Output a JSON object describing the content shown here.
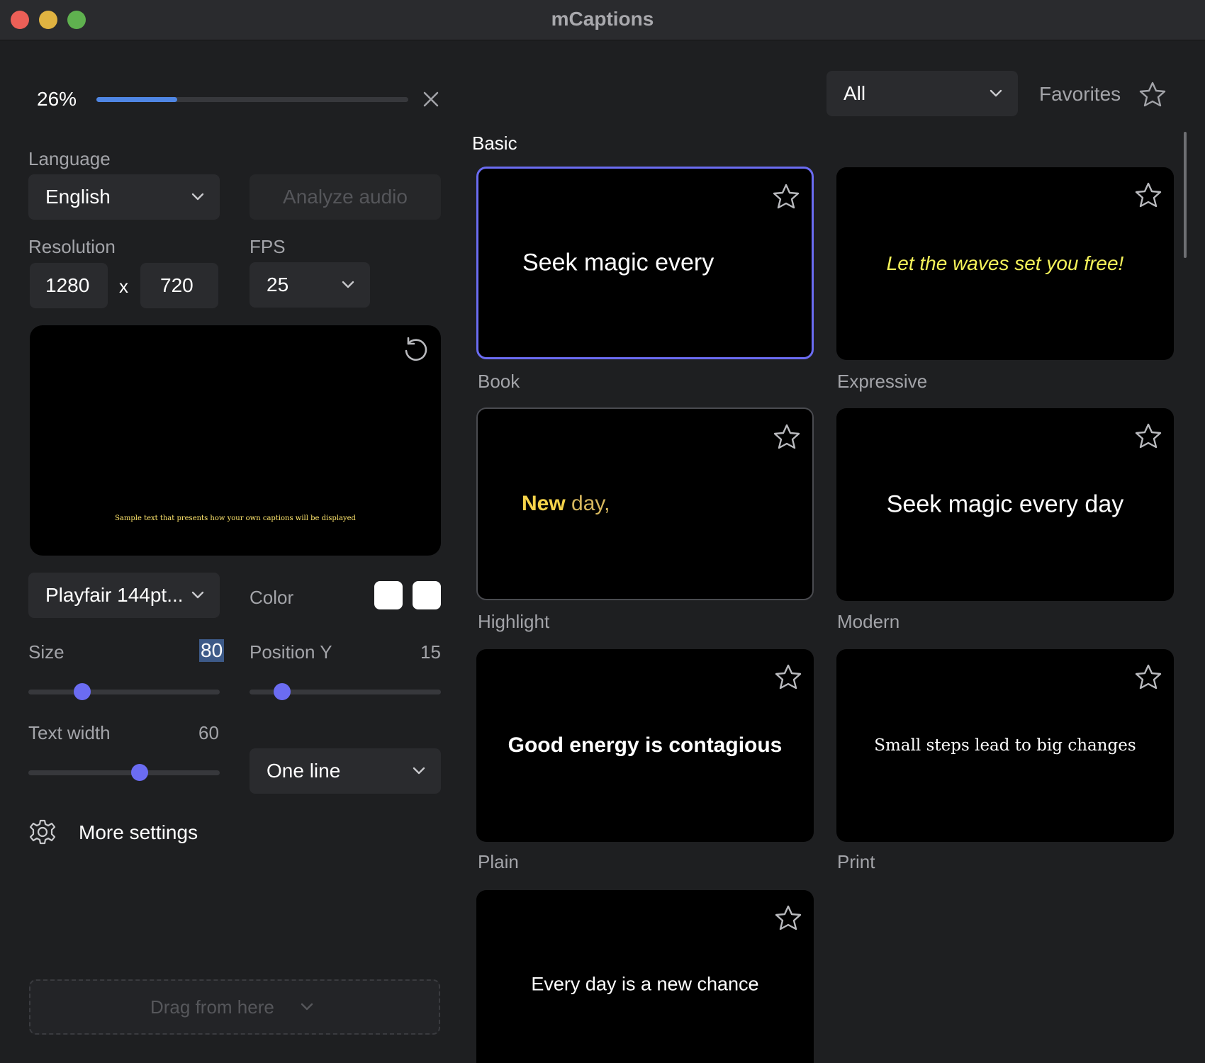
{
  "window": {
    "title": "mCaptions"
  },
  "progress": {
    "label": "26%",
    "value": 0.26
  },
  "language": {
    "label": "Language",
    "value": "English"
  },
  "analyze_button": "Analyze audio",
  "resolution": {
    "label": "Resolution",
    "width": "1280",
    "separator": "x",
    "height": "720"
  },
  "fps": {
    "label": "FPS",
    "value": "25"
  },
  "preview": {
    "caption": "Sample text that presents how your own captions will be displayed"
  },
  "font": {
    "value": "Playfair 144pt..."
  },
  "color": {
    "label": "Color",
    "swatches": [
      "#ffffff",
      "#ffffff"
    ]
  },
  "size": {
    "label": "Size",
    "value": "80",
    "fraction": 0.28
  },
  "position_y": {
    "label": "Position Y",
    "value": "15",
    "fraction": 0.17
  },
  "text_width": {
    "label": "Text width",
    "value": "60",
    "fraction": 0.58
  },
  "line_mode": {
    "value": "One line"
  },
  "more_settings": "More settings",
  "drag": "Drag from here",
  "filter": {
    "value": "All"
  },
  "favorites": "Favorites",
  "section": "Basic",
  "styles": [
    {
      "name": "Book",
      "sample": "Seek magic every",
      "color": "#ffffff",
      "selected": true
    },
    {
      "name": "Expressive",
      "sample": "Let the waves set you free!",
      "color": "#f4f25a"
    },
    {
      "name": "Highlight",
      "sample_hl": "New",
      "sample_rest": " day,",
      "color": "#f5d34a",
      "rest_color": "#d6b65e"
    },
    {
      "name": "Modern",
      "sample": "Seek magic every day",
      "color": "#ffffff"
    },
    {
      "name": "Plain",
      "sample": "Good energy is contagious",
      "color": "#ffffff"
    },
    {
      "name": "Print",
      "sample": "Small steps lead to big changes",
      "color": "#ffffff"
    },
    {
      "name": "",
      "sample": "Every day is a new chance",
      "color": "#ffffff"
    }
  ],
  "colors": {
    "accent": "#6b6cf2",
    "progress": "#4f86e4",
    "background": "#1e1f21",
    "panel": "#2a2b2e"
  }
}
